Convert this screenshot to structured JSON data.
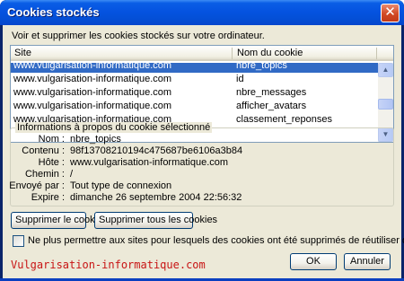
{
  "window": {
    "title": "Cookies stockés",
    "close_glyph": "✕"
  },
  "intro_text": "Voir et supprimer les cookies stockés sur votre ordinateur.",
  "list": {
    "columns": [
      "Site",
      "Nom du cookie"
    ],
    "rows": [
      {
        "site": "www.vulgarisation-informatique.com",
        "name": "nbre_topics",
        "selected": true
      },
      {
        "site": "www.vulgarisation-informatique.com",
        "name": "id"
      },
      {
        "site": "www.vulgarisation-informatique.com",
        "name": "nbre_messages"
      },
      {
        "site": "www.vulgarisation-informatique.com",
        "name": "afficher_avatars"
      },
      {
        "site": "www.vulgarisation-informatique.com",
        "name": "classement_reponses"
      }
    ]
  },
  "details": {
    "legend": "Informations à propos du cookie sélectionné",
    "fields": [
      {
        "label": "Nom :",
        "value": "nbre_topics"
      },
      {
        "label": "Contenu :",
        "value": "98f13708210194c475687be6106a3b84"
      },
      {
        "label": "Hôte :",
        "value": "www.vulgarisation-informatique.com"
      },
      {
        "label": "Chemin :",
        "value": "/"
      },
      {
        "label": "Envoyé par :",
        "value": "Tout type de connexion"
      },
      {
        "label": "Expire :",
        "value": "dimanche 26 septembre 2004 22:56:32"
      }
    ]
  },
  "buttons": {
    "remove_one": "Supprimer le cookie",
    "remove_all": "Supprimer tous les cookies",
    "ok": "OK",
    "cancel": "Annuler"
  },
  "checkbox": {
    "label": "Ne plus permettre aux sites pour lesquels des cookies ont été supprimés de réutiliser des cookies à l'avenir",
    "checked": false
  },
  "watermark": "Vulgarisation-informatique.com",
  "colors": {
    "selection": "#316ac5",
    "titlebar": "#0553e0",
    "watermark": "#c81414"
  }
}
